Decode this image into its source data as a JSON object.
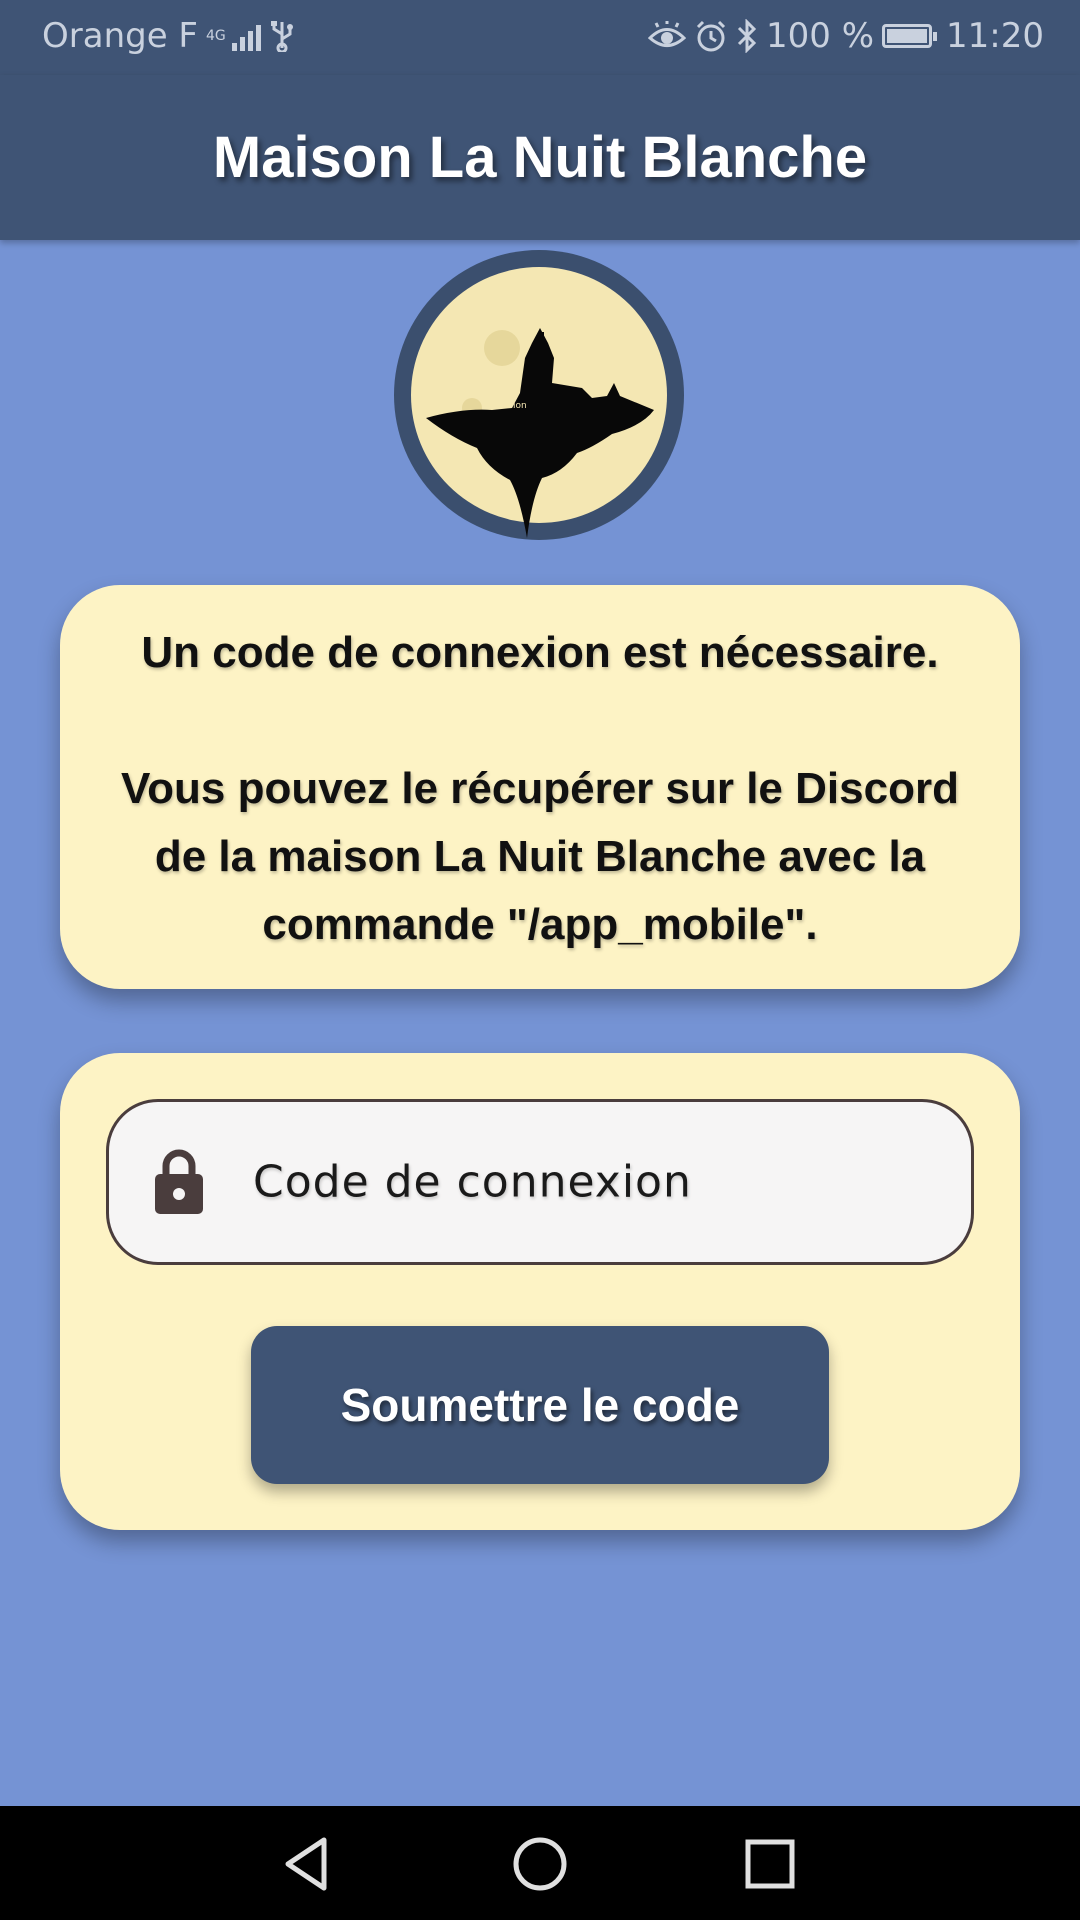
{
  "status_bar": {
    "carrier": "Orange F",
    "network_type": "4G",
    "battery_percent": "100 %",
    "battery_level": 1.0,
    "time": "11:20",
    "icons": [
      "signal-icon",
      "usb-icon",
      "eye-icon",
      "alarm-icon",
      "bluetooth-icon",
      "battery-icon"
    ]
  },
  "app_bar": {
    "title": "Maison La Nuit Blanche"
  },
  "logo": {
    "icon": "moon-castle-logo",
    "label": "Pension"
  },
  "info_card": {
    "line1": "Un code de connexion est nécessaire.",
    "line2": "Vous pouvez le récupérer sur le Discord de la maison La Nuit Blanche avec la commande \"/app_mobile\"."
  },
  "form": {
    "code_placeholder": "Code de connexion",
    "code_value": "",
    "lock_icon": "lock-icon",
    "submit_label": "Soumettre le code"
  },
  "nav_bar": {
    "buttons": [
      "back-icon",
      "home-icon",
      "recents-icon"
    ]
  },
  "colors": {
    "background": "#7593d4",
    "bar": "#3f5475",
    "card": "#fdf3c5",
    "field": "#f6f5f5"
  }
}
